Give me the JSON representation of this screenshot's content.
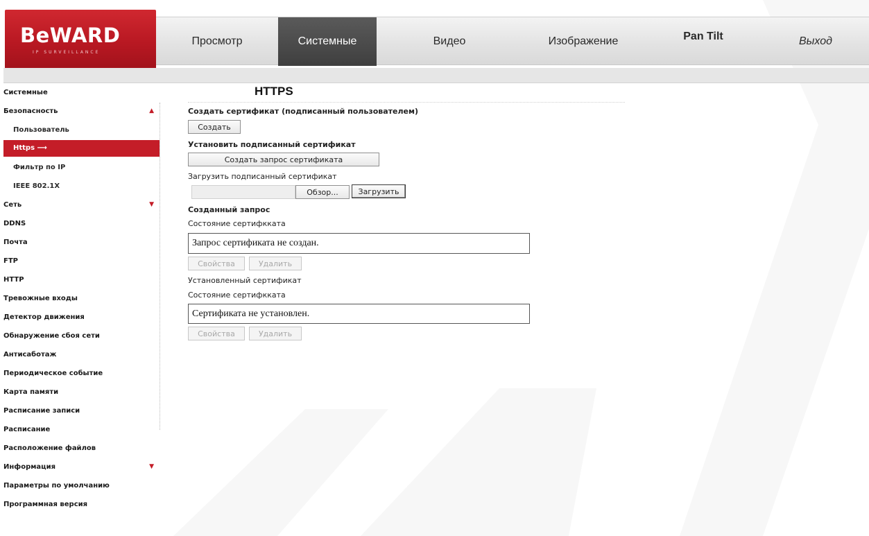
{
  "brand": {
    "name": "BeWARD",
    "tagline": "IP SURVEILLANCE"
  },
  "nav": {
    "items": [
      {
        "label": "Просмотр"
      },
      {
        "label": "Системные",
        "active": true
      },
      {
        "label": "Видео"
      },
      {
        "label": "Изображение"
      },
      {
        "label": "Pan Tilt"
      },
      {
        "label": "Выход"
      }
    ]
  },
  "sidebar": {
    "items": [
      {
        "label": "Системные"
      },
      {
        "label": "Безопасность",
        "arrow": "up"
      },
      {
        "label": "Пользователь",
        "sub": true
      },
      {
        "label": "Https",
        "sub": true,
        "active": true,
        "marker": "⟶"
      },
      {
        "label": "Фильтр по IP",
        "sub": true
      },
      {
        "label": "IEEE 802.1X",
        "sub": true
      },
      {
        "label": "Сеть",
        "arrow": "down"
      },
      {
        "label": "DDNS"
      },
      {
        "label": "Почта"
      },
      {
        "label": "FTP"
      },
      {
        "label": "HTTP"
      },
      {
        "label": "Тревожные входы"
      },
      {
        "label": "Детектор движения"
      },
      {
        "label": "Обнаружение сбоя сети"
      },
      {
        "label": "Антисаботаж"
      },
      {
        "label": "Периодическое событие"
      },
      {
        "label": "Карта памяти"
      },
      {
        "label": "Расписание записи"
      },
      {
        "label": "Расписание"
      },
      {
        "label": "Расположение файлов"
      },
      {
        "label": "Информация",
        "arrow": "down"
      },
      {
        "label": "Параметры по умолчанию"
      },
      {
        "label": "Программная версия"
      }
    ]
  },
  "content": {
    "title": "HTTPS",
    "create_cert_label": "Создать сертификат (подписанный пользователем)",
    "create_button": "Создать",
    "install_cert_label": "Установить подписанный сертификат",
    "create_request_button": "Создать запрос сертификата",
    "upload_label": "Загрузить подписанный сертификат",
    "browse_button": "Обзор...",
    "upload_button": "Загрузить",
    "created_request_label": "Созданный запрос",
    "request_status_label": "Состояние сертифкката",
    "request_status_value": "Запрос сертификата не создан.",
    "properties_button": "Свойства",
    "delete_button": "Удалить",
    "installed_cert_label": "Установленный сертификат",
    "installed_status_label": "Состояние сертифкката",
    "installed_status_value": "Сертификата не установлен."
  },
  "colors": {
    "accent": "#c41d28",
    "nav_active": "#4a4a4a"
  }
}
